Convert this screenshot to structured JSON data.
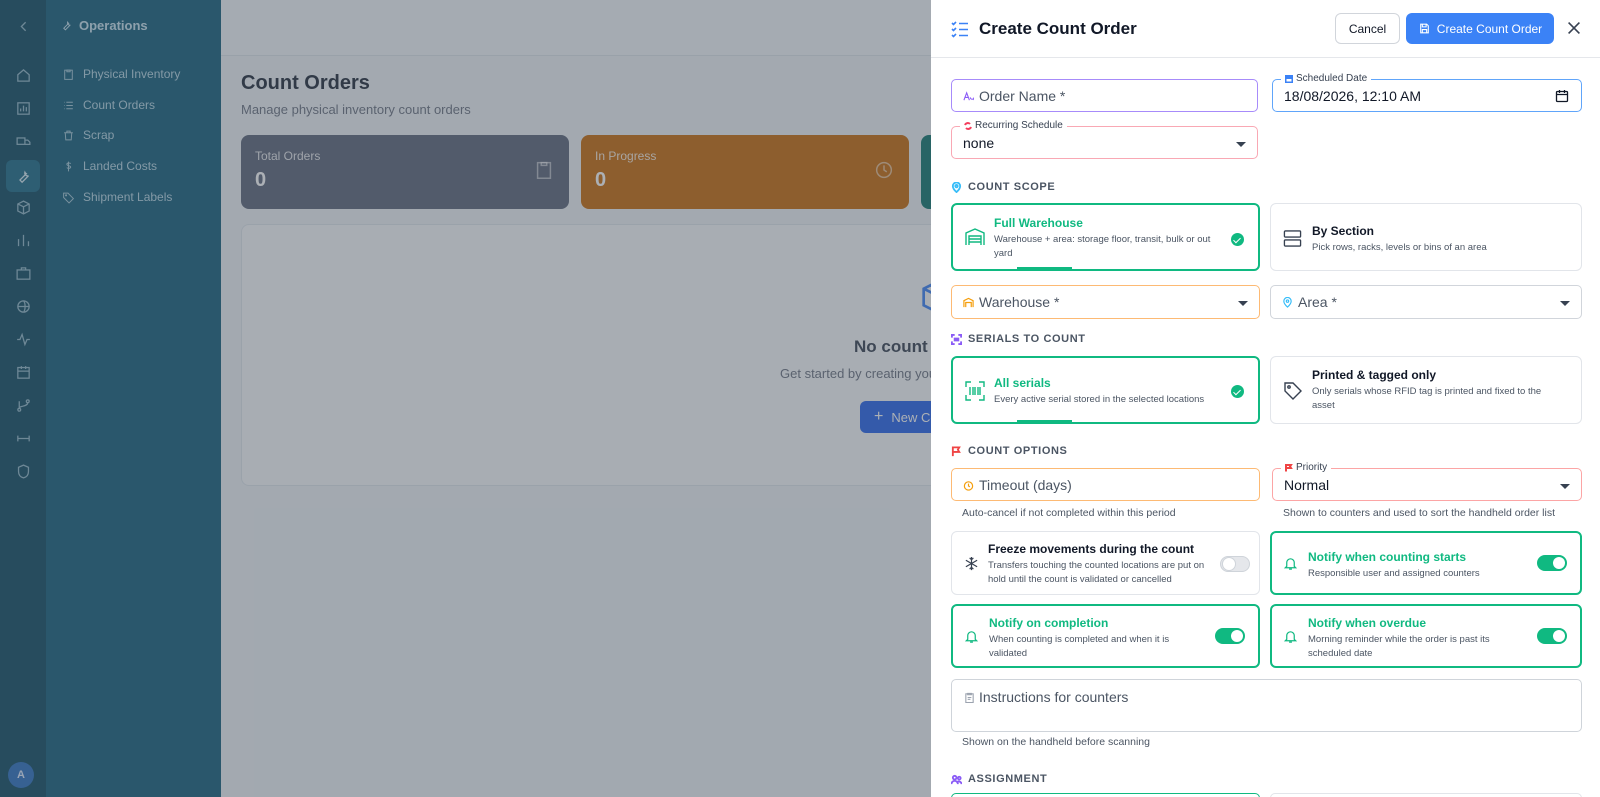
{
  "background": {
    "subnav": {
      "title": "Operations",
      "items": [
        {
          "label": "Physical Inventory",
          "icon": "clipboard-icon"
        },
        {
          "label": "Count Orders",
          "icon": "list-icon"
        },
        {
          "label": "Scrap",
          "icon": "trash-icon"
        },
        {
          "label": "Landed Costs",
          "icon": "dollar-icon"
        },
        {
          "label": "Shipment Labels",
          "icon": "tag-icon"
        }
      ]
    },
    "avatar_initial": "A",
    "page": {
      "title": "Count Orders",
      "subtitle": "Manage physical inventory count orders"
    },
    "stats": [
      {
        "label": "Total Orders",
        "value": "0",
        "color": "#5b6478"
      },
      {
        "label": "In Progress",
        "value": "0",
        "color": "#c76b0a"
      }
    ],
    "empty_state": {
      "title": "No count or",
      "subtitle": "Get started by creating your fi",
      "button": "New Cou"
    }
  },
  "panel": {
    "title": "Create Count Order",
    "cancel_label": "Cancel",
    "create_label": "Create Count Order",
    "order_name": {
      "placeholder": "Order Name *"
    },
    "scheduled_date": {
      "label": "Scheduled Date",
      "value": "18/08/2026, 12:10 AM"
    },
    "recurring": {
      "label": "Recurring Schedule",
      "value": "none"
    },
    "count_scope": {
      "heading": "COUNT SCOPE",
      "options": [
        {
          "title": "Full Warehouse",
          "description": "Warehouse + area: storage floor, transit, bulk or out yard",
          "selected": true
        },
        {
          "title": "By Section",
          "description": "Pick rows, racks, levels or bins of an area",
          "selected": false
        }
      ]
    },
    "warehouse": {
      "placeholder": "Warehouse *"
    },
    "area": {
      "placeholder": "Area *"
    },
    "serials": {
      "heading": "SERIALS TO COUNT",
      "options": [
        {
          "title": "All serials",
          "description": "Every active serial stored in the selected locations",
          "selected": true
        },
        {
          "title": "Printed & tagged only",
          "description": "Only serials whose RFID tag is printed and fixed to the asset",
          "selected": false
        }
      ]
    },
    "count_options": {
      "heading": "COUNT OPTIONS",
      "timeout": {
        "placeholder": "Timeout (days)",
        "helper": "Auto-cancel if not completed within this period"
      },
      "priority": {
        "label": "Priority",
        "value": "Normal",
        "helper": "Shown to counters and used to sort the handheld order list"
      },
      "toggles": [
        {
          "title": "Freeze movements during the count",
          "description": "Transfers touching the counted locations are put on hold until the count is validated or cancelled",
          "on": false
        },
        {
          "title": "Notify when counting starts",
          "description": "Responsible user and assigned counters",
          "on": true
        },
        {
          "title": "Notify on completion",
          "description": "When counting is completed and when it is validated",
          "on": true
        },
        {
          "title": "Notify when overdue",
          "description": "Morning reminder while the order is past its scheduled date",
          "on": true
        }
      ]
    },
    "instructions": {
      "placeholder": "Instructions for counters",
      "helper": "Shown on the handheld before scanning"
    },
    "assignment": {
      "heading": "ASSIGNMENT"
    }
  },
  "colors": {
    "accent": "#3b82f6",
    "success": "#10b981",
    "sidebar": "#0e4a62"
  }
}
